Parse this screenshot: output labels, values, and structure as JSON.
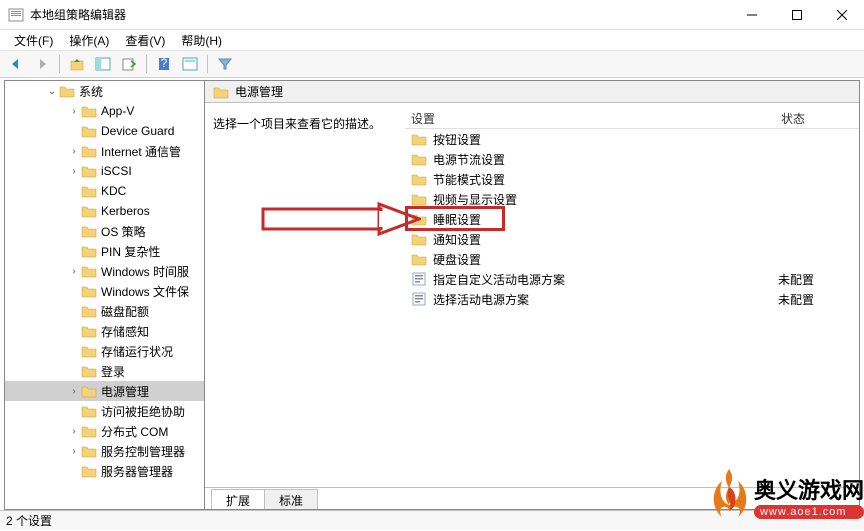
{
  "window": {
    "title": "本地组策略编辑器"
  },
  "menu": {
    "file": "文件(F)",
    "action": "操作(A)",
    "view": "查看(V)",
    "help": "帮助(H)"
  },
  "tree": {
    "root_label": "系统",
    "items": [
      {
        "label": "App-V",
        "expandable": true
      },
      {
        "label": "Device Guard",
        "expandable": false
      },
      {
        "label": "Internet 通信管",
        "expandable": true
      },
      {
        "label": "iSCSI",
        "expandable": true
      },
      {
        "label": "KDC",
        "expandable": false
      },
      {
        "label": "Kerberos",
        "expandable": false
      },
      {
        "label": "OS 策略",
        "expandable": false
      },
      {
        "label": "PIN 复杂性",
        "expandable": false
      },
      {
        "label": "Windows 时间服",
        "expandable": true
      },
      {
        "label": "Windows 文件保",
        "expandable": false
      },
      {
        "label": "磁盘配额",
        "expandable": false
      },
      {
        "label": "存储感知",
        "expandable": false
      },
      {
        "label": "存储运行状况",
        "expandable": false
      },
      {
        "label": "登录",
        "expandable": false
      },
      {
        "label": "电源管理",
        "expandable": true,
        "selected": true
      },
      {
        "label": "访问被拒绝协助",
        "expandable": false
      },
      {
        "label": "分布式 COM",
        "expandable": true
      },
      {
        "label": "服务控制管理器",
        "expandable": true
      },
      {
        "label": "服务器管理器",
        "expandable": false
      }
    ]
  },
  "detail": {
    "header": "电源管理",
    "description": "选择一个项目来查看它的描述。",
    "columns": {
      "setting": "设置",
      "status": "状态"
    },
    "items": [
      {
        "type": "folder",
        "label": "按钮设置"
      },
      {
        "type": "folder",
        "label": "电源节流设置"
      },
      {
        "type": "folder",
        "label": "节能模式设置"
      },
      {
        "type": "folder",
        "label": "视频与显示设置"
      },
      {
        "type": "folder",
        "label": "睡眠设置",
        "highlighted": true
      },
      {
        "type": "folder",
        "label": "通知设置"
      },
      {
        "type": "folder",
        "label": "硬盘设置"
      },
      {
        "type": "setting",
        "label": "指定自定义活动电源方案",
        "status": "未配置"
      },
      {
        "type": "setting",
        "label": "选择活动电源方案",
        "status": "未配置"
      }
    ]
  },
  "tabs": {
    "extended": "扩展",
    "standard": "标准"
  },
  "statusbar": "2 个设置",
  "watermark": {
    "name": "奥义游戏网",
    "url": "www.aoe1.com"
  }
}
